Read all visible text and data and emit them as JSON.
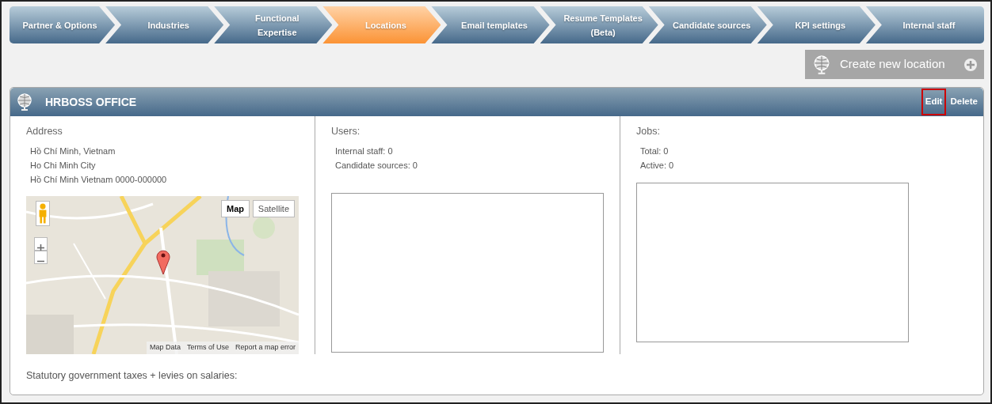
{
  "tabs": [
    {
      "label": "Partner & Options",
      "selected": false
    },
    {
      "label": "Industries",
      "selected": false
    },
    {
      "label": "Functional\nExpertise",
      "selected": false
    },
    {
      "label": "Locations",
      "selected": true
    },
    {
      "label": "Email templates",
      "selected": false
    },
    {
      "label": "Resume Templates\n(Beta)",
      "selected": false
    },
    {
      "label": "Candidate sources",
      "selected": false
    },
    {
      "label": "KPI settings",
      "selected": false
    },
    {
      "label": "Internal staff",
      "selected": false
    }
  ],
  "create_button": {
    "label": "Create new location"
  },
  "location": {
    "name": "HRBOSS OFFICE",
    "actions": [
      {
        "label": "Edit",
        "highlighted": true
      },
      {
        "label": "Delete",
        "highlighted": false
      }
    ],
    "address": {
      "heading": "Address",
      "lines": [
        "Hồ Chí Minh, Vietnam",
        "Ho Chi Minh City",
        "Hồ Chí Minh Vietnam 0000-000000"
      ]
    },
    "map": {
      "kind": "picture",
      "map_types": [
        {
          "label": "Map",
          "selected": true
        },
        {
          "label": "Satellite",
          "selected": false
        }
      ],
      "footer_links": [
        "Map Data",
        "Terms of Use",
        "Report a map error"
      ]
    },
    "users": {
      "heading": "Users:",
      "lines": [
        "Internal staff: 0",
        "Candidate sources: 0"
      ]
    },
    "jobs": {
      "heading": "Jobs:",
      "lines": [
        "Total: 0",
        "Active: 0"
      ]
    },
    "taxes_label": "Statutory government taxes + levies on salaries:"
  }
}
